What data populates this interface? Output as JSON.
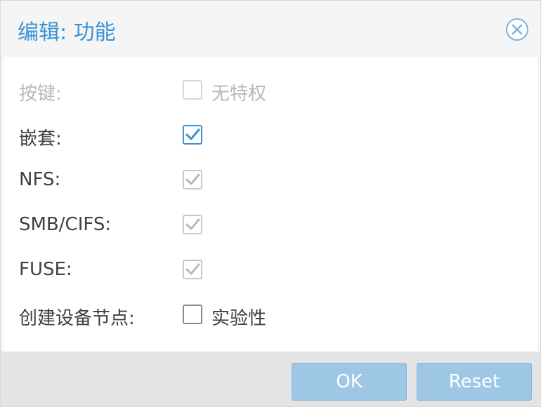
{
  "dialog": {
    "title": "编辑: 功能",
    "close_icon": "close-circle-icon"
  },
  "rows": [
    {
      "label": "按键:",
      "checkbox_label": "无特权",
      "checked": false,
      "disabled": true
    },
    {
      "label": "嵌套:",
      "checkbox_label": "",
      "checked": true,
      "disabled": false
    },
    {
      "label": "NFS:",
      "checkbox_label": "",
      "checked": true,
      "disabled": true
    },
    {
      "label": "SMB/CIFS:",
      "checkbox_label": "",
      "checked": true,
      "disabled": true
    },
    {
      "label": "FUSE:",
      "checkbox_label": "",
      "checked": true,
      "disabled": true
    },
    {
      "label": "创建设备节点:",
      "checkbox_label": "实验性",
      "checked": false,
      "disabled": false
    }
  ],
  "footer": {
    "ok_label": "OK",
    "reset_label": "Reset"
  },
  "colors": {
    "accent": "#3892d4",
    "button_disabled": "#9ec7e6",
    "checkbox_disabled": "#c8c8c8"
  }
}
